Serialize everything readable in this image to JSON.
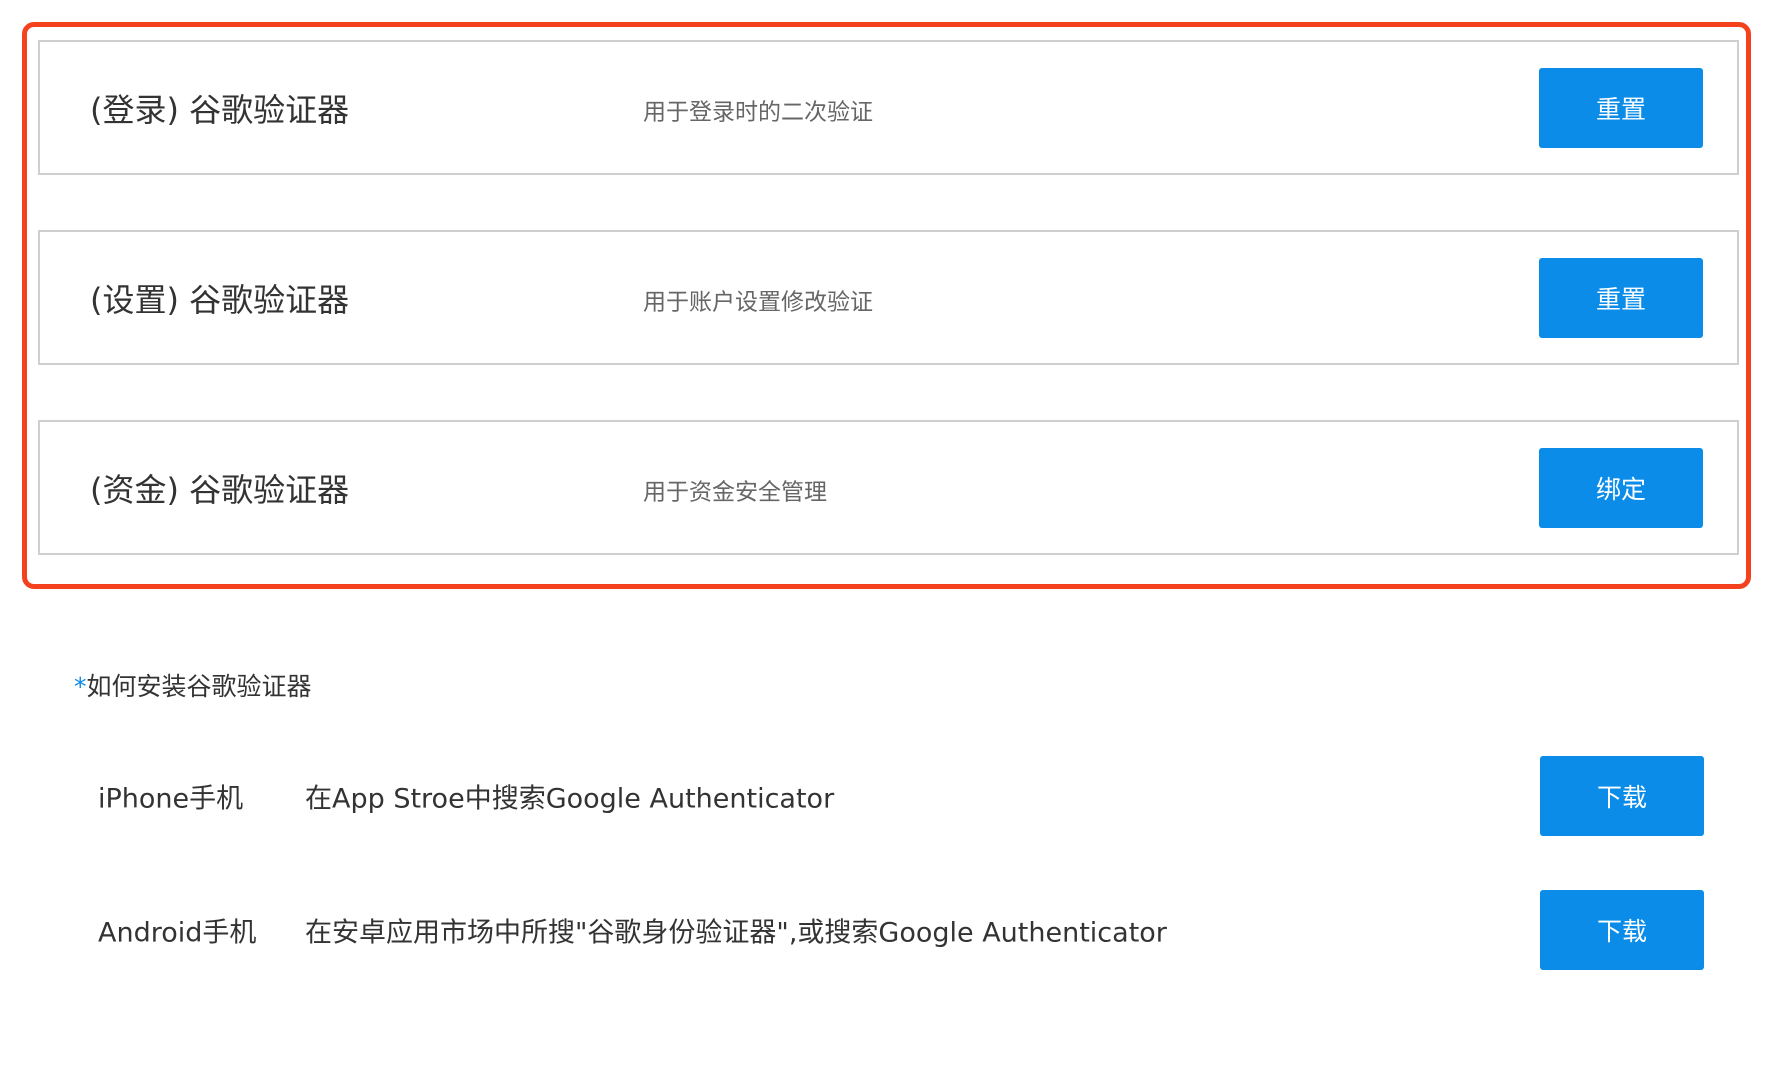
{
  "authenticators": [
    {
      "title": "(登录) 谷歌验证器",
      "description": "用于登录时的二次验证",
      "action_label": "重置"
    },
    {
      "title": "(设置) 谷歌验证器",
      "description": "用于账户设置修改验证",
      "action_label": "重置"
    },
    {
      "title": "(资金) 谷歌验证器",
      "description": "用于资金安全管理",
      "action_label": "绑定"
    }
  ],
  "install": {
    "star": "*",
    "title": "如何安装谷歌验证器",
    "rows": [
      {
        "platform": "iPhone手机",
        "instruction": "在App Stroe中搜索Google Authenticator",
        "action_label": "下载"
      },
      {
        "platform": "Android手机",
        "instruction": "在安卓应用市场中所搜\"谷歌身份验证器\",或搜索Google Authenticator",
        "action_label": "下载"
      }
    ]
  },
  "colors": {
    "accent": "#0b8ce9",
    "highlight_border": "#f4411e",
    "card_border": "#cfcfcf"
  }
}
